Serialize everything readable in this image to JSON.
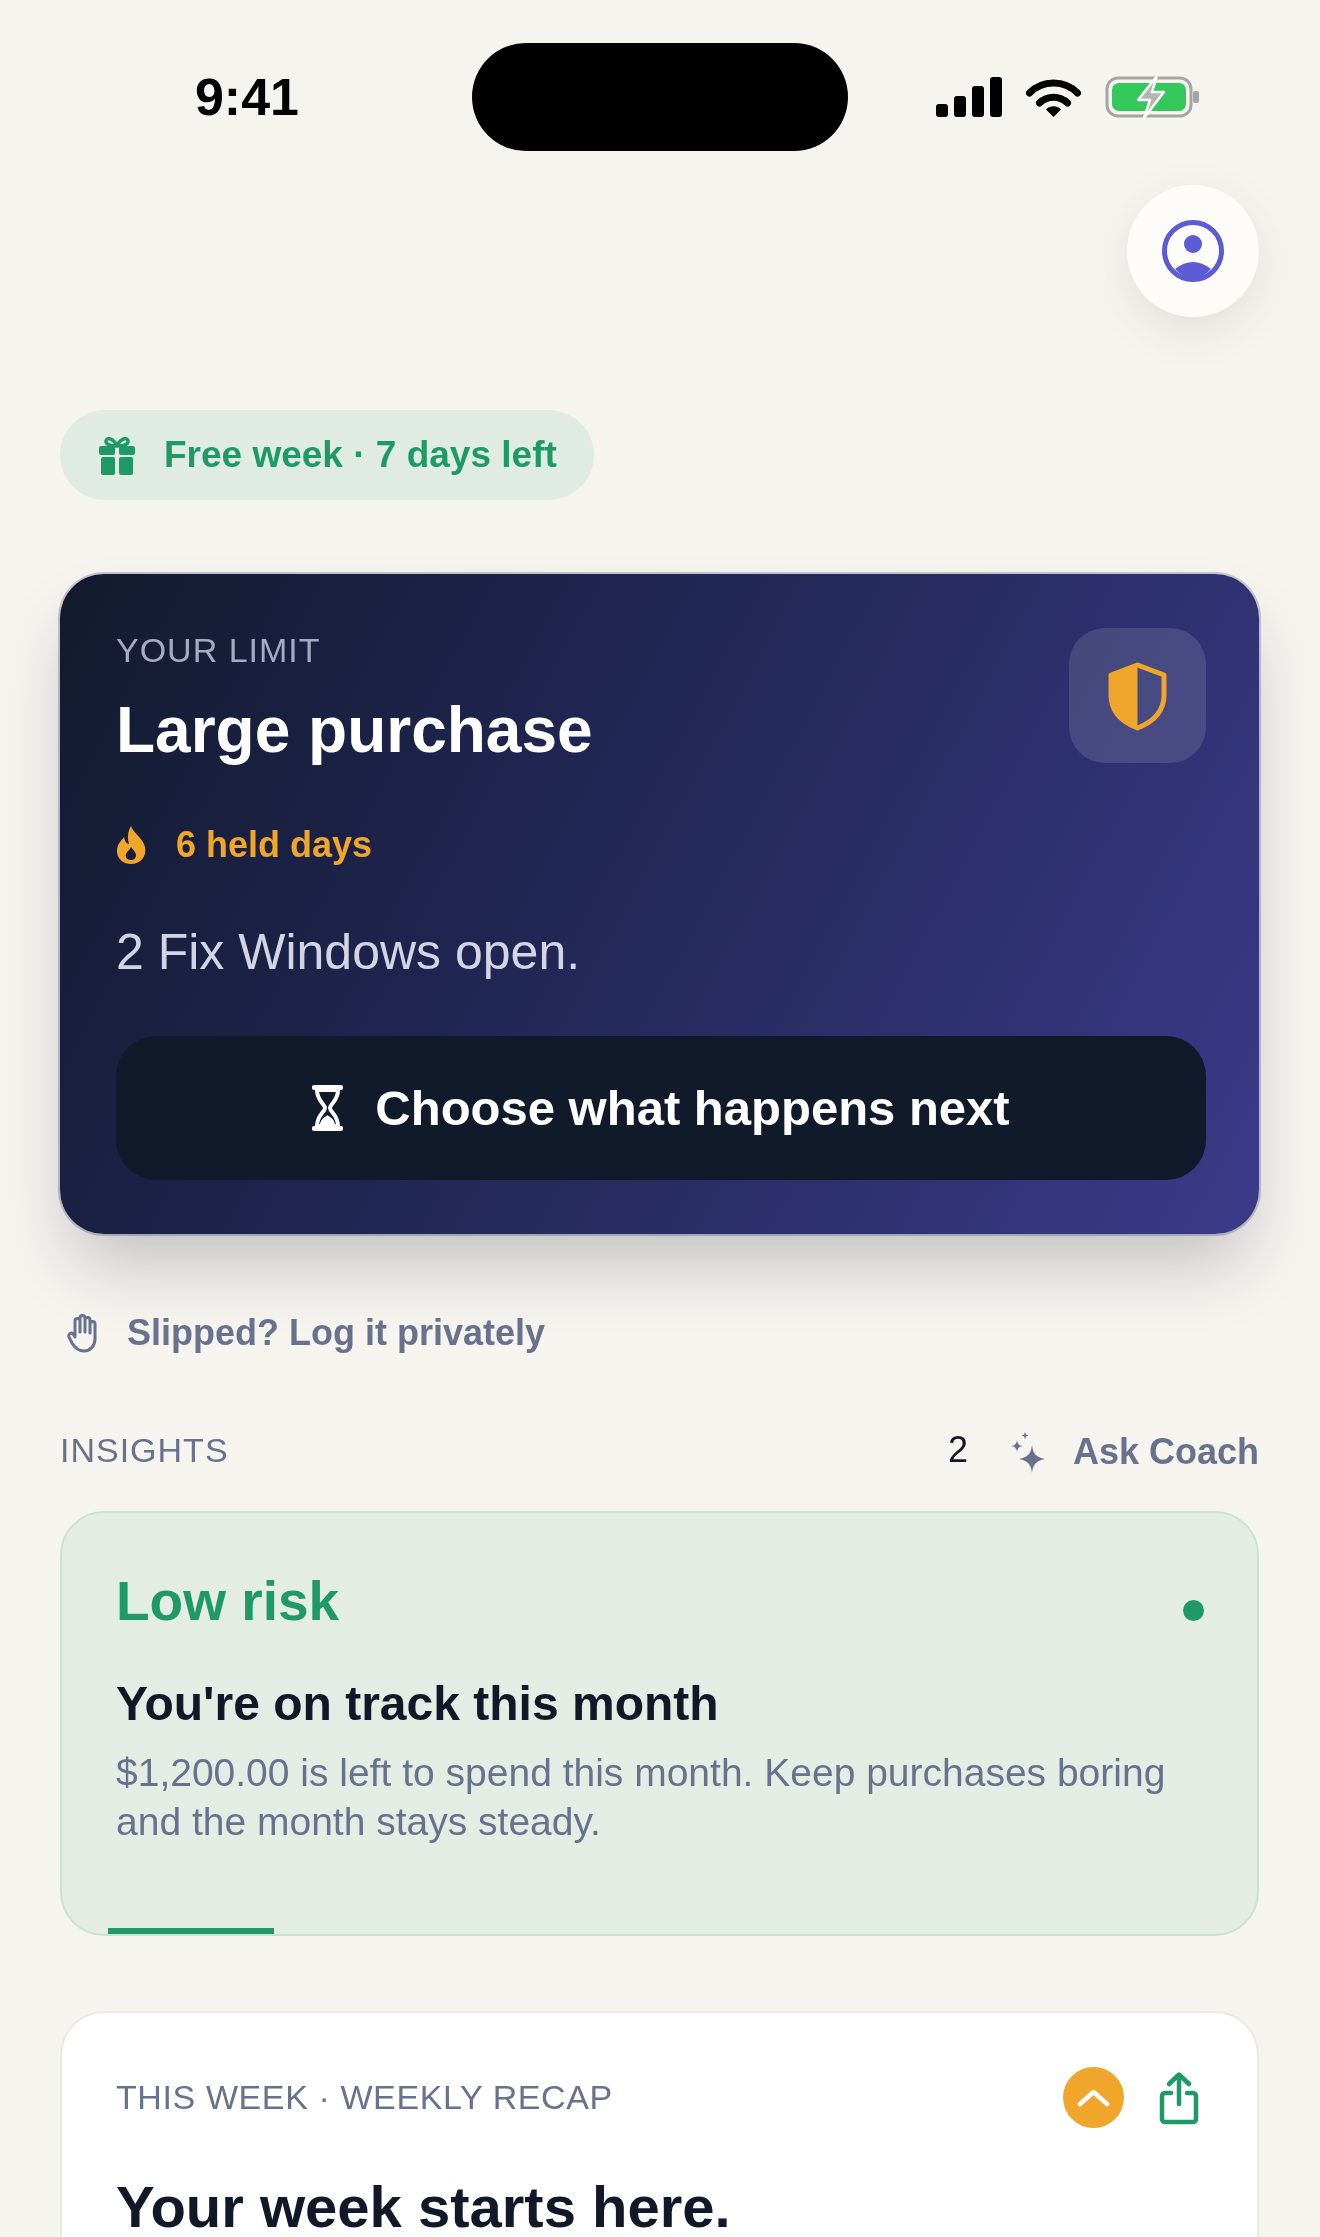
{
  "status_bar": {
    "time": "9:41"
  },
  "trial_badge": {
    "label": "Free week · 7 days left"
  },
  "limit_card": {
    "eyebrow": "YOUR LIMIT",
    "title": "Large purchase",
    "streak": "6 held days",
    "message": "2 Fix Windows open.",
    "action": "Choose what happens next"
  },
  "slip_link": {
    "label": "Slipped? Log it privately"
  },
  "insights": {
    "heading": "INSIGHTS",
    "count": "2",
    "coach_link": "Ask Coach",
    "cards": [
      {
        "risk": "Low risk",
        "color": "#1f9a66",
        "title": "You're on track this month",
        "body": "$1,200.00 is left to spend this month. Keep purchases boring and the month stays steady.",
        "level": 0.15
      }
    ]
  },
  "recap": {
    "eyebrow": "THIS WEEK · WEEKLY RECAP",
    "expanded": true,
    "title": "Your week starts here."
  }
}
